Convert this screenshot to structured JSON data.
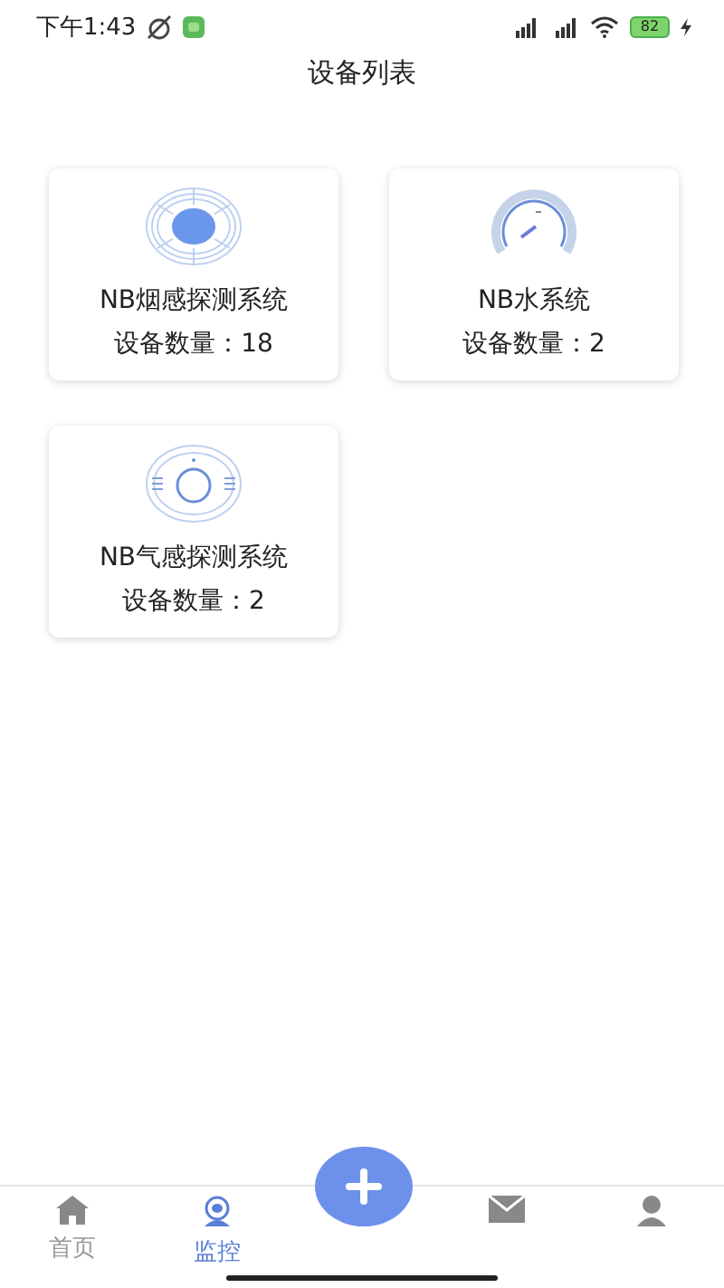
{
  "status_bar": {
    "time": "下午1:43",
    "battery": "82"
  },
  "title": "设备列表",
  "devices": [
    {
      "kind": "smoke",
      "name": "NB烟感探测系统",
      "count": "设备数量：18"
    },
    {
      "kind": "water",
      "name": "NB水系统",
      "count": "设备数量：2"
    },
    {
      "kind": "gas",
      "name": "NB气感探测系统",
      "count": "设备数量：2"
    }
  ],
  "tab_bar": {
    "tabs": [
      {
        "kind": "home",
        "label": "首页",
        "selected": false
      },
      {
        "kind": "monitor",
        "label": "监控",
        "selected": true
      },
      {
        "kind": "add",
        "selected": false
      },
      {
        "kind": "mail",
        "selected": false
      },
      {
        "kind": "user",
        "selected": false
      }
    ]
  }
}
